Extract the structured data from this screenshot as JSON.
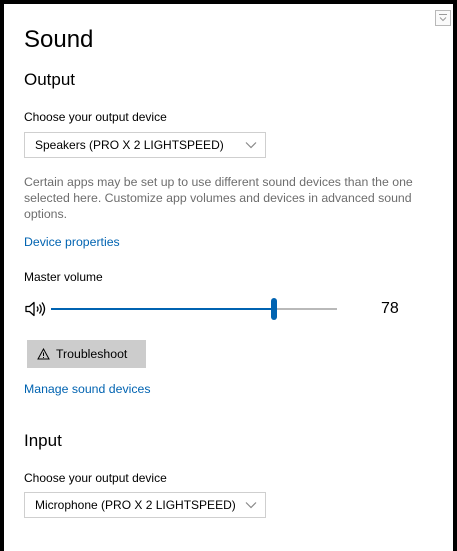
{
  "page": {
    "title": "Sound"
  },
  "output": {
    "heading": "Output",
    "device_label": "Choose your output device",
    "device_value": "Speakers (PRO X 2 LIGHTSPEED)",
    "description": "Certain apps may be set up to use different sound devices than the one selected here. Customize app volumes and devices in advanced sound options.",
    "device_properties_link": "Device properties",
    "master_volume_label": "Master volume",
    "master_volume_value": 78,
    "volume_display": "78",
    "troubleshoot_label": "Troubleshoot",
    "manage_devices_link": "Manage sound devices"
  },
  "input": {
    "heading": "Input",
    "device_label": "Choose your output device",
    "device_value": "Microphone (PRO X 2 LIGHTSPEED)"
  },
  "icons": {
    "volume": "speaker-volume-icon",
    "warning": "warning-triangle-icon",
    "chevron": "chevron-down-icon",
    "corner": "collapse-icon"
  },
  "colors": {
    "accent": "#0063b1",
    "button_bg": "#cccccc",
    "secondary_text": "#6d6d6d"
  }
}
